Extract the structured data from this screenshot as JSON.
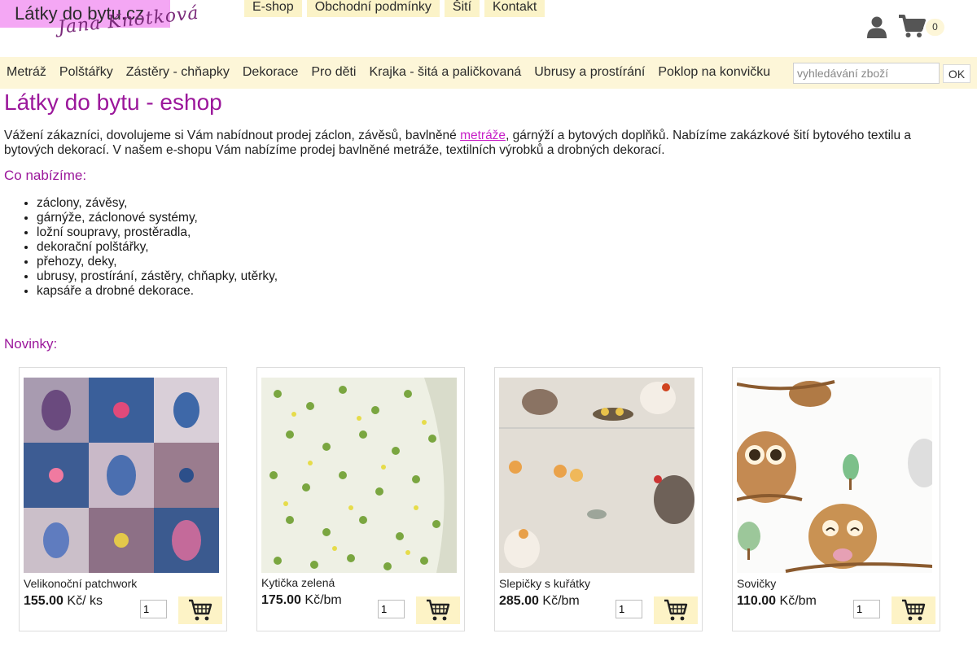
{
  "brand": {
    "title": "Látky do bytu.cz",
    "signature": "Jana Knotková"
  },
  "top_nav": [
    "E-shop",
    "Obchodní podmínky",
    "Šití",
    "Kontakt"
  ],
  "header_icons": {
    "user_icon": "user-icon",
    "cart_icon": "shopping-cart-icon",
    "cart_count": "0"
  },
  "categories": [
    "Metráž",
    "Polštářky",
    "Zástěry - chňapky",
    "Dekorace",
    "Pro děti",
    "Krajka - šitá a paličkovaná",
    "Ubrusy a prostírání",
    "Poklop na konvičku"
  ],
  "search": {
    "placeholder": "vyhledávání zboží",
    "button": "OK"
  },
  "page": {
    "title": "Látky do bytu - eshop",
    "intro_before_link": "Vážení zákazníci, dovolujeme si Vám nabídnout prodej záclon, závěsů, bavlněné ",
    "intro_link": "metráže",
    "intro_after_link": ", gárnýží a bytových doplňků. Nabízíme zakázkové šití bytového textilu a bytových dekorací. V našem e-shopu Vám nabízíme prodej bavlněné metráže, textilních výrobků a drobných dekorací.",
    "offer_heading": "Co nabízíme:",
    "offer_items": [
      "záclony, závěsy,",
      "gárnýže, záclonové systémy,",
      "ložní soupravy, prostěradla,",
      "dekorační polštářky,",
      "přehozy, deky,",
      "ubrusy, prostírání, zástěry, chňapky, utěrky,",
      "kapsáře a drobné dekorace."
    ],
    "news_heading": "Novinky:"
  },
  "products": [
    {
      "name": "Velikonoční patchwork",
      "price": "155.00",
      "unit": "Kč/ ks",
      "qty": "1",
      "cart_icon": "add-to-cart-icon"
    },
    {
      "name": "Kytička zelená",
      "price": "175.00",
      "unit": "Kč/bm",
      "qty": "1",
      "cart_icon": "add-to-cart-icon"
    },
    {
      "name": "Slepičky s kuřátky",
      "price": "285.00",
      "unit": "Kč/bm",
      "qty": "1",
      "cart_icon": "add-to-cart-icon"
    },
    {
      "name": "Sovičky",
      "price": "110.00",
      "unit": "Kč/bm",
      "qty": "1",
      "cart_icon": "add-to-cart-icon"
    }
  ],
  "colors": {
    "accent_purple": "#9b179b",
    "logo_pink": "#f4a7f4",
    "nav_cream": "#fbf3c8",
    "link_pink": "#c71fc7"
  }
}
